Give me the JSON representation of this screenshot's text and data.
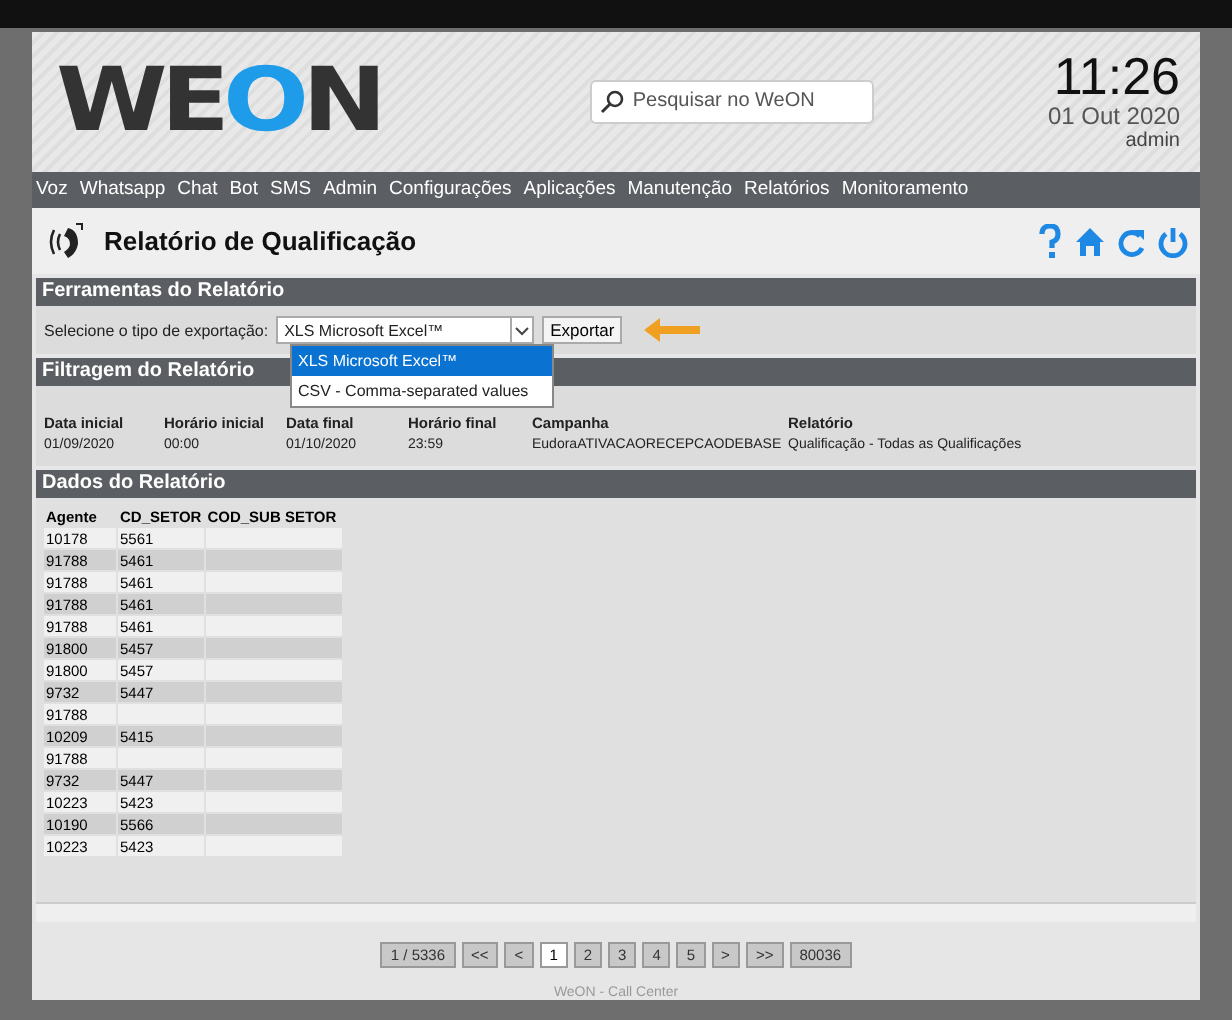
{
  "logo": {
    "text": "WEON"
  },
  "search": {
    "placeholder": "Pesquisar no WeON"
  },
  "clock": {
    "time": "11:26",
    "date": "01 Out 2020",
    "user": "admin"
  },
  "nav": [
    "Voz",
    "Whatsapp",
    "Chat",
    "Bot",
    "SMS",
    "Admin",
    "Configurações",
    "Aplicações",
    "Manutenção",
    "Relatórios",
    "Monitoramento"
  ],
  "page_title": "Relatório de Qualificação",
  "tools": {
    "title": "Ferramentas do Relatório",
    "label": "Selecione o tipo de exportação:",
    "value": "XLS Microsoft Excel™",
    "expanded": true,
    "options": [
      {
        "label": "XLS Microsoft Excel™",
        "selected": true
      },
      {
        "label": "CSV - Comma-separated values",
        "selected": false
      }
    ],
    "button": "Exportar"
  },
  "filter": {
    "title": "Filtragem do Relatório",
    "fields": [
      {
        "label": "Data inicial",
        "value": "01/09/2020"
      },
      {
        "label": "Horário inicial",
        "value": "00:00"
      },
      {
        "label": "Data final",
        "value": "01/10/2020"
      },
      {
        "label": "Horário final",
        "value": "23:59"
      },
      {
        "label": "Campanha",
        "value": "EudoraATIVACAORECEPCAODEBASE"
      },
      {
        "label": "Relatório",
        "value": "Qualificação - Todas as Qualificações"
      }
    ]
  },
  "data": {
    "title": "Dados do Relatório",
    "columns": [
      "Agente",
      "CD_SETOR",
      "COD_SUB SETOR"
    ],
    "rows": [
      [
        "10178",
        "5561",
        ""
      ],
      [
        "91788",
        "5461",
        ""
      ],
      [
        "91788",
        "5461",
        ""
      ],
      [
        "91788",
        "5461",
        ""
      ],
      [
        "91788",
        "5461",
        ""
      ],
      [
        "91800",
        "5457",
        ""
      ],
      [
        "91800",
        "5457",
        ""
      ],
      [
        "9732",
        "5447",
        ""
      ],
      [
        "91788",
        "",
        ""
      ],
      [
        "10209",
        "5415",
        ""
      ],
      [
        "91788",
        "",
        ""
      ],
      [
        "9732",
        "5447",
        ""
      ],
      [
        "10223",
        "5423",
        ""
      ],
      [
        "10190",
        "5566",
        ""
      ],
      [
        "10223",
        "5423",
        ""
      ]
    ]
  },
  "pagination": [
    {
      "label": "1 / 5336",
      "selected": false
    },
    {
      "label": "<<",
      "selected": false
    },
    {
      "label": "<",
      "selected": false
    },
    {
      "label": "1",
      "selected": true
    },
    {
      "label": "2",
      "selected": false
    },
    {
      "label": "3",
      "selected": false
    },
    {
      "label": "4",
      "selected": false
    },
    {
      "label": "5",
      "selected": false
    },
    {
      "label": ">",
      "selected": false
    },
    {
      "label": ">>",
      "selected": false
    },
    {
      "label": "80036",
      "selected": false
    }
  ],
  "footer": "WeON - Call Center"
}
